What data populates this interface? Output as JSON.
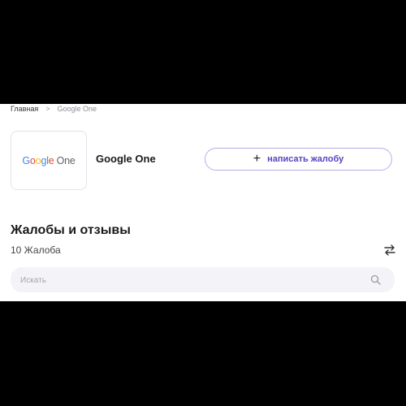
{
  "breadcrumb": {
    "home": "Главная",
    "separator": ">",
    "current": "Google One"
  },
  "company": {
    "logo_word": "Google",
    "logo_suffix": "One",
    "name": "Google One"
  },
  "actions": {
    "write_complaint": "написать жалобу"
  },
  "reviews": {
    "title": "Жалобы и отзывы",
    "count_text": "10 Жалоба"
  },
  "search": {
    "placeholder": "Искать"
  },
  "colors": {
    "accent": "#5a3fc0",
    "button_border": "#b7aee6",
    "search_bg": "#f4f4f8",
    "google_blue": "#4285F4",
    "google_red": "#EA4335",
    "google_yellow": "#FBBC05",
    "google_green": "#34A853"
  }
}
